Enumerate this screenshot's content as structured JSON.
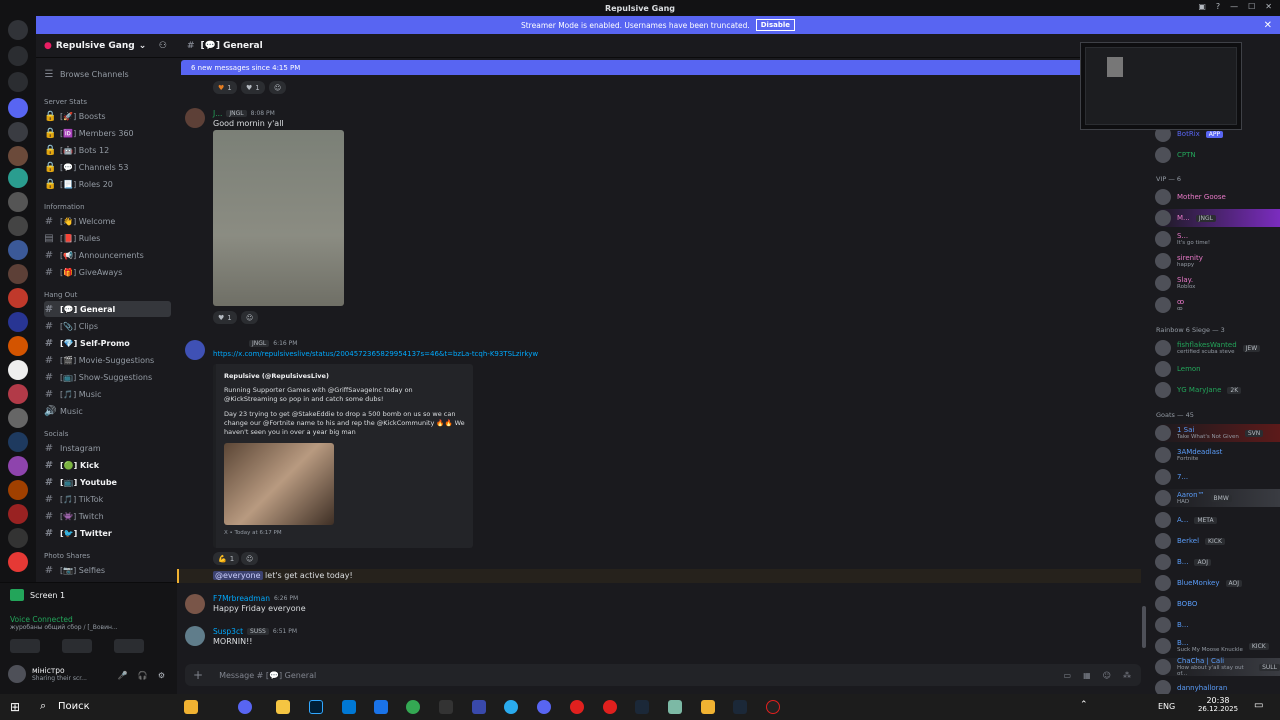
{
  "titlebar": {
    "title": "Repulsive Gang"
  },
  "banner": {
    "text": "Streamer Mode is enabled. Usernames have been truncated.",
    "button": "Disable"
  },
  "server": {
    "name": "Repulsive Gang",
    "browse": "Browse Channels"
  },
  "categories": {
    "server_stats": "Server Stats",
    "information": "Information",
    "hangout": "Hang Out",
    "socials": "Socials",
    "photo": "Photo Shares"
  },
  "channels": [
    {
      "label": "[🚀] Boosts"
    },
    {
      "label": "[🆔] Members 360"
    },
    {
      "label": "[🤖] Bots 12"
    },
    {
      "label": "[💬] Channels 53"
    },
    {
      "label": "[📃] Roles 20"
    },
    {
      "label": "[👋] Welcome"
    },
    {
      "label": "[📕] Rules"
    },
    {
      "label": "[📢] Announcements"
    },
    {
      "label": "[🎁] GiveAways"
    },
    {
      "label": "[💬] General"
    },
    {
      "label": "[📎] Clips"
    },
    {
      "label": "[💎] Self-Promo"
    },
    {
      "label": "[🎬] Movie-Suggestions"
    },
    {
      "label": "[📺] Show-Suggestions"
    },
    {
      "label": "[🎵] Music"
    },
    {
      "label": "Music"
    },
    {
      "label": "Instagram"
    },
    {
      "label": "[🟢] Kick"
    },
    {
      "label": "[📺] Youtube"
    },
    {
      "label": "[🎵] TikTok"
    },
    {
      "label": "[👾] Twitch"
    },
    {
      "label": "[🐦] Twitter"
    },
    {
      "label": "[📷] Selfies"
    }
  ],
  "user_panel": {
    "screen": "Screen 1",
    "voice": "Voice Connected",
    "voice_sub": "журобаны общий сбор / [_Вовин...",
    "username": "міністро",
    "user_status": "Sharing their scr..."
  },
  "chat": {
    "channel": "[💬] General",
    "new_messages": "6 new messages since 4:15 PM",
    "messages": [
      {
        "author": "J...",
        "tag": "JNGL",
        "time": "8:08 PM",
        "text": "Good mornin y'all"
      },
      {
        "author": "",
        "tag": "JNGL",
        "time": "6:16 PM",
        "link": "https://x.com/repulsiveslive/status/2004572365829954137s=46&t=bzLa-tcqh-K93TSLzirkyw"
      },
      {
        "author": "",
        "text_mention": "@everyone",
        "text": "let's get active today!"
      },
      {
        "author": "F7Mrbreadman",
        "time": "6:26 PM",
        "text": "Happy Friday everyone"
      },
      {
        "author": "Susp3ct",
        "tag": "SUSS",
        "time": "6:51 PM",
        "text": "MORNIN!!"
      }
    ],
    "embed": {
      "author": "Repulsive (@RepulsivesLive)",
      "p1": "Running Supporter Games with @GriffSavageInc today on @KickStreaming so pop in and catch some dubs!",
      "p2": "Day 23 trying to get @StakeEddie to drop a 500 bomb on us so we can change our @Fortnite name to his and rep the @KickCommunity 🔥🔥 We haven't seen you in over a year big man",
      "footer": "X • Today at 6:17 PM"
    },
    "reactions": {
      "r1a": "1",
      "r1b": "1",
      "r2": "1",
      "r3": "1"
    },
    "composer_placeholder": "Message # [💬] General"
  },
  "members": {
    "vip_header": "VIP — 6",
    "rainbow_header": "Rainbow 6 Siege — 3",
    "goats_header": "Goats — 45",
    "top": [
      {
        "name": "BotRix",
        "badge": "APP"
      },
      {
        "name": "CPTN"
      }
    ],
    "vip": [
      {
        "name": "Mother Goose"
      },
      {
        "name": "M...",
        "badge": "JNGL"
      },
      {
        "name": "S...",
        "status": "It's go time!"
      },
      {
        "name": "sirenity",
        "status": "happy"
      },
      {
        "name": "Slay.",
        "status": "Roblox"
      },
      {
        "name": "ꝏ",
        "status": "ꝏ"
      }
    ],
    "rainbow": [
      {
        "name": "fishflakesWanted",
        "badge": "JEW",
        "status": "certified scuba steve"
      },
      {
        "name": "Lemon"
      },
      {
        "name": "YG MaryJane",
        "badge": "2K"
      }
    ],
    "goats": [
      {
        "name": "1 Sai",
        "badge": "SVN",
        "status": "Take What's Not Given"
      },
      {
        "name": "3AMdeadlast",
        "status": "Fortnite"
      },
      {
        "name": "7..."
      },
      {
        "name": "Aaron™",
        "badge": "BMW",
        "status": "HAD"
      },
      {
        "name": "A...",
        "badge": "META"
      },
      {
        "name": "Berkel",
        "badge": "KICK"
      },
      {
        "name": "B...",
        "badge": "AOJ"
      },
      {
        "name": "BlueMonkey",
        "badge": "AOJ"
      },
      {
        "name": "BOBO"
      },
      {
        "name": "B..."
      },
      {
        "name": "B...",
        "badge": "KICK",
        "status": "Suck My Moose Knuckle"
      },
      {
        "name": "ChaCha | Cali",
        "badge": "SULL",
        "status": "How about y'all stay out of..."
      },
      {
        "name": "dannyhalloran"
      }
    ]
  },
  "taskbar": {
    "search": "Поиск",
    "lang": "ENG",
    "time": "20:38",
    "date": "26.12.2025"
  },
  "colors": {
    "accent": "#5865f2",
    "bg": "#1a1a1e",
    "link": "#00a8fc"
  }
}
